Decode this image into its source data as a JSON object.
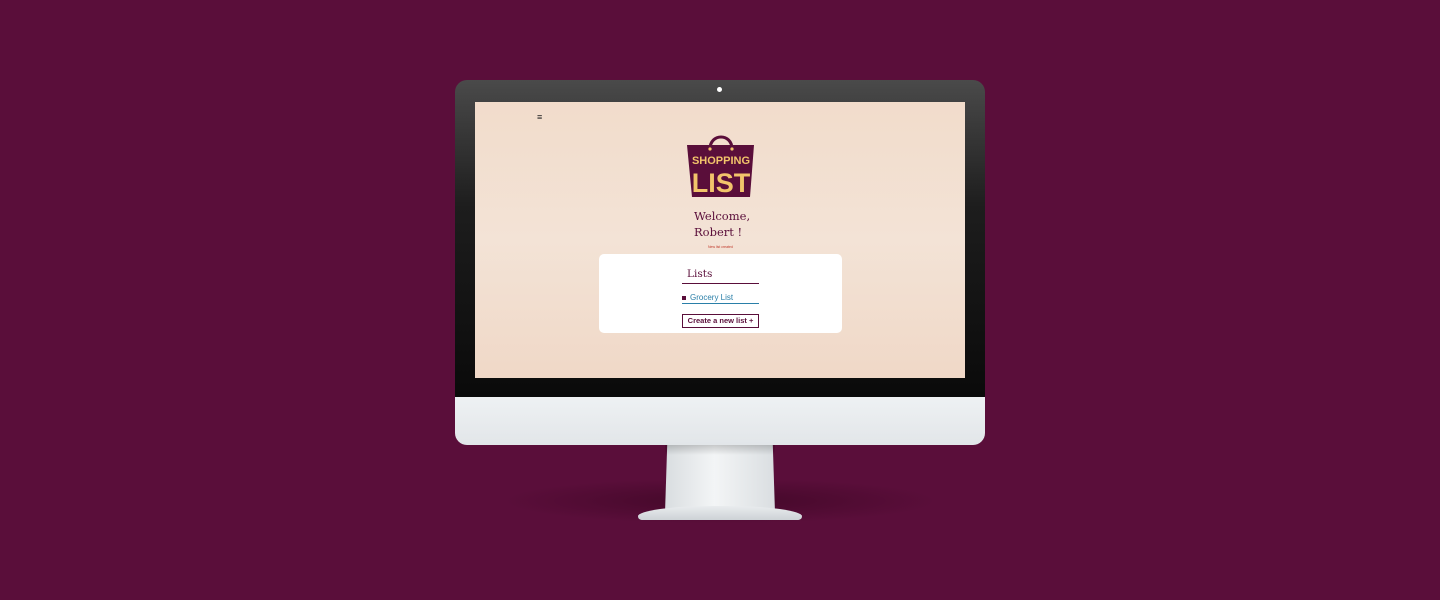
{
  "colors": {
    "background": "#5a0e3a",
    "brand": "#5a0e3a",
    "logo_text": "#f2c46b",
    "link": "#2a7fa8",
    "screen_bg": "#f2dccb"
  },
  "app": {
    "menu_icon": "hamburger-icon",
    "logo": {
      "line1": "SHOPPING",
      "line2": "LIST",
      "icon": "shopping-bag-icon"
    },
    "welcome": {
      "line1": "Welcome,",
      "line2": "Robert !"
    },
    "status_text": "New list created"
  },
  "lists_panel": {
    "heading": "Lists",
    "items": [
      {
        "label": "Grocery List"
      }
    ],
    "create_button_label": "Create a new list +"
  }
}
